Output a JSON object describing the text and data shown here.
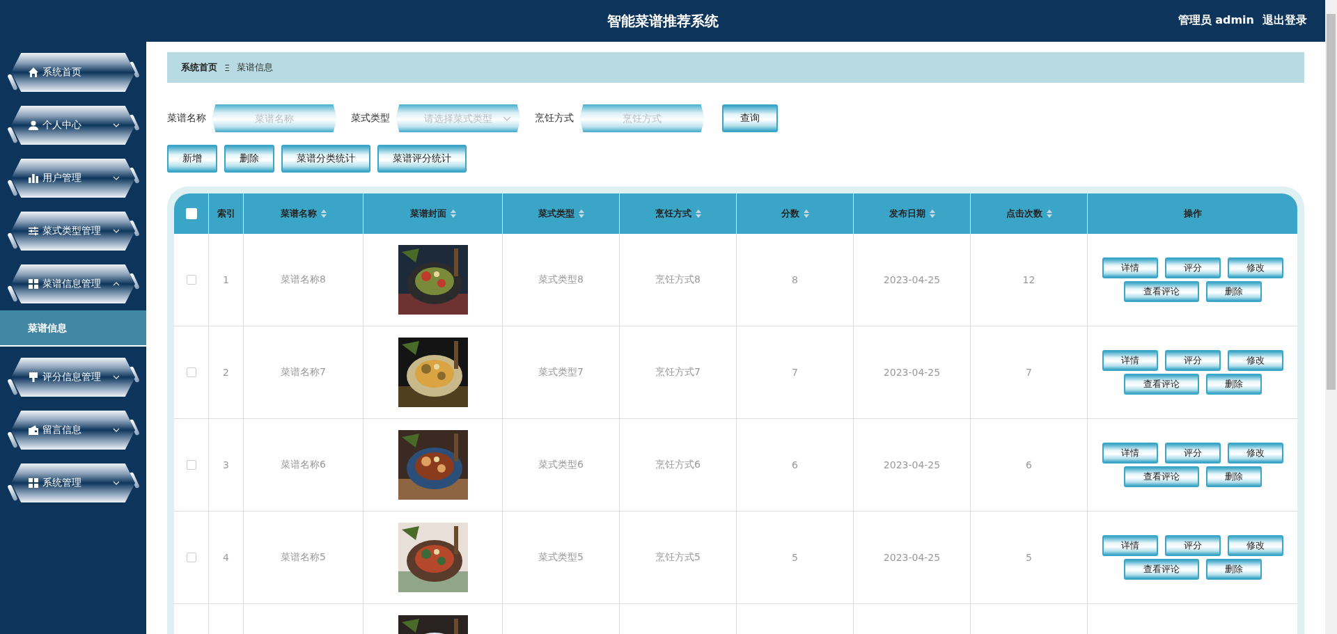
{
  "header": {
    "title": "智能菜谱推荐系统",
    "user": "管理员 admin",
    "logout": "退出登录"
  },
  "sidebar": {
    "items": [
      {
        "label": "系统首页",
        "kind": "link"
      },
      {
        "label": "个人中心",
        "kind": "menu",
        "expanded": false
      },
      {
        "label": "用户管理",
        "kind": "menu",
        "expanded": false
      },
      {
        "label": "菜式类型管理",
        "kind": "menu",
        "expanded": false
      },
      {
        "label": "菜谱信息管理",
        "kind": "menu",
        "expanded": true,
        "children": [
          {
            "label": "菜谱信息",
            "selected": true
          }
        ]
      },
      {
        "label": "评分信息管理",
        "kind": "menu",
        "expanded": false
      },
      {
        "label": "留言信息",
        "kind": "menu",
        "expanded": false
      },
      {
        "label": "系统管理",
        "kind": "menu",
        "expanded": false
      }
    ]
  },
  "breadcrumb": {
    "home": "系统首页",
    "separator": "Ξ",
    "current": "菜谱信息"
  },
  "search": {
    "fields": [
      {
        "label": "菜谱名称",
        "placeholder": "菜谱名称",
        "kind": "text"
      },
      {
        "label": "菜式类型",
        "placeholder": "请选择菜式类型",
        "kind": "select"
      },
      {
        "label": "烹饪方式",
        "placeholder": "烹饪方式",
        "kind": "text"
      }
    ],
    "button": "查询"
  },
  "toolbar": [
    "新增",
    "删除",
    "菜谱分类统计",
    "菜谱评分统计"
  ],
  "table": {
    "select_all": {
      "checked": false
    },
    "columns": [
      {
        "label": "索引",
        "sortable": false
      },
      {
        "label": "菜谱名称",
        "sortable": true
      },
      {
        "label": "菜谱封面",
        "sortable": true
      },
      {
        "label": "菜式类型",
        "sortable": true
      },
      {
        "label": "烹饪方式",
        "sortable": true
      },
      {
        "label": "分数",
        "sortable": true
      },
      {
        "label": "发布日期",
        "sortable": true
      },
      {
        "label": "点击次数",
        "sortable": true
      },
      {
        "label": "操作",
        "sortable": false
      }
    ],
    "rows": [
      {
        "checked": false,
        "index": "1",
        "name": "菜谱名称8",
        "cover": {
          "kind": "picture"
        },
        "type": "菜式类型8",
        "method": "烹饪方式8",
        "score": "8",
        "date": "2023-04-25",
        "clicks": "12",
        "actions": [
          "详情",
          "评分",
          "修改",
          "查看评论",
          "删除"
        ]
      },
      {
        "checked": false,
        "index": "2",
        "name": "菜谱名称7",
        "cover": {
          "kind": "picture"
        },
        "type": "菜式类型7",
        "method": "烹饪方式7",
        "score": "7",
        "date": "2023-04-25",
        "clicks": "7",
        "actions": [
          "详情",
          "评分",
          "修改",
          "查看评论",
          "删除"
        ]
      },
      {
        "checked": false,
        "index": "3",
        "name": "菜谱名称6",
        "cover": {
          "kind": "picture"
        },
        "type": "菜式类型6",
        "method": "烹饪方式6",
        "score": "6",
        "date": "2023-04-25",
        "clicks": "6",
        "actions": [
          "详情",
          "评分",
          "修改",
          "查看评论",
          "删除"
        ]
      },
      {
        "checked": false,
        "index": "4",
        "name": "菜谱名称5",
        "cover": {
          "kind": "picture"
        },
        "type": "菜式类型5",
        "method": "烹饪方式5",
        "score": "5",
        "date": "2023-04-25",
        "clicks": "5",
        "actions": [
          "详情",
          "评分",
          "修改",
          "查看评论",
          "删除"
        ]
      },
      {
        "cover": {
          "kind": "picture"
        }
      }
    ]
  }
}
